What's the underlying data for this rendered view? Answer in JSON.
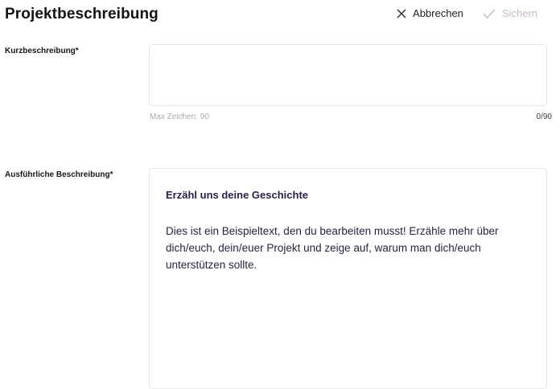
{
  "header": {
    "title": "Projektbeschreibung",
    "cancel_label": "Abbrechen",
    "save_label": "Sichern"
  },
  "short_description": {
    "label": "Kurzbeschreibung*",
    "value": "",
    "hint": "Max Zeichen: 90",
    "counter": "0/90"
  },
  "long_description": {
    "label": "Ausführliche Beschreibung*",
    "heading": "Erzähl uns deine Geschichte",
    "body": "Dies ist ein Beispieltext, den du bearbeiten musst! Erzähle mehr über dich/euch, dein/euer Projekt und zeige auf, warum man dich/euch unterstützen sollte."
  },
  "icons": {
    "cancel": "close-icon",
    "save": "checkmark-icon"
  },
  "colors": {
    "title": "#141414",
    "save_disabled": "#c7b6c9",
    "editor_text": "#2b2140",
    "hint": "#a9a9a9",
    "border": "#e6e6e6"
  }
}
